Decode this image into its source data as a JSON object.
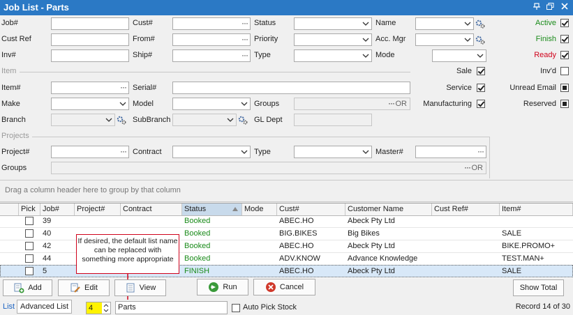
{
  "window": {
    "title": "Job List - Parts"
  },
  "filters": {
    "job_label": "Job#",
    "cust_label": "Cust#",
    "status_label": "Status",
    "name_label": "Name",
    "custref_label": "Cust Ref",
    "from_label": "From#",
    "priority_label": "Priority",
    "accmgr_label": "Acc. Mgr",
    "inv_label": "Inv#",
    "ship_label": "Ship#",
    "type_label": "Type",
    "mode_label": "Mode",
    "active_label": "Active",
    "finish_label": "Finish",
    "ready_label": "Ready",
    "item_section": "Item",
    "item_label": "Item#",
    "serial_label": "Serial#",
    "make_label": "Make",
    "model_label": "Model",
    "groups_label": "Groups",
    "branch_label": "Branch",
    "subbranch_label": "SubBranch",
    "gldept_label": "GL Dept",
    "sale_label": "Sale",
    "service_label": "Service",
    "manufacturing_label": "Manufacturing",
    "invd_label": "Inv'd",
    "unread_label": "Unread Email",
    "reserved_label": "Reserved",
    "projects_section": "Projects",
    "project_label": "Project#",
    "contract_label": "Contract",
    "ptype_label": "Type",
    "master_label": "Master#",
    "pgroups_label": "Groups",
    "or_text": "OR",
    "dots": "···"
  },
  "colors": {
    "active": "#1a8b1a",
    "finish": "#1a8b1a",
    "ready": "#d0021b",
    "titlebar": "#2b79c5"
  },
  "group_hint": "Drag a column header here to group by that column",
  "grid": {
    "columns": [
      "Pick",
      "Job#",
      "Project#",
      "Contract",
      "Status",
      "Mode",
      "Cust#",
      "Customer Name",
      "Cust Ref#",
      "Item#"
    ],
    "rows": [
      {
        "job": "39",
        "status": "Booked",
        "cust": "ABEC.HO",
        "name": "Abeck Pty Ltd",
        "item": ""
      },
      {
        "job": "40",
        "status": "Booked",
        "cust": "BIG.BIKES",
        "name": "Big Bikes",
        "item": "SALE"
      },
      {
        "job": "42",
        "status": "Booked",
        "cust": "ABEC.HO",
        "name": "Abeck Pty Ltd",
        "item": "BIKE.PROMO+"
      },
      {
        "job": "44",
        "status": "Booked",
        "cust": "ADV.KNOW",
        "name": "Advance Knowledge",
        "item": "TEST.MAN+"
      },
      {
        "job": "5",
        "status": "FINISH",
        "cust": "ABEC.HO",
        "name": "Abeck Pty Ltd",
        "item": "SALE"
      }
    ]
  },
  "callout": {
    "text": "If desired, the default list name can be replaced with something more appropriate"
  },
  "buttons": {
    "add": "Add",
    "edit": "Edit",
    "view": "View",
    "run": "Run",
    "cancel": "Cancel",
    "show_total": "Show Total"
  },
  "status": {
    "list_tab": "List",
    "advanced_tab": "Advanced List",
    "spin_value": "4",
    "list_name": "Parts",
    "auto_pick_label": "Auto Pick Stock",
    "record": "Record 14 of 30"
  }
}
